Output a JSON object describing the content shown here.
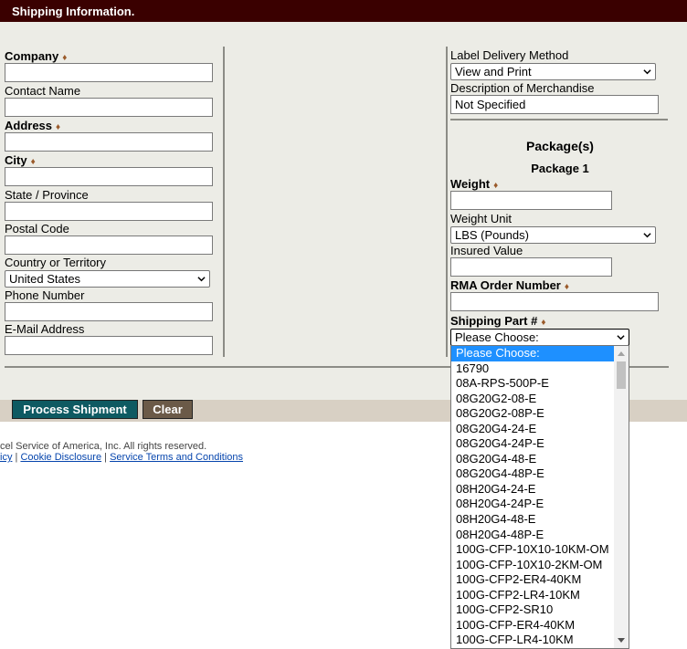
{
  "header": {
    "title": "Shipping Information."
  },
  "left_form": {
    "company": {
      "label": "Company",
      "value": ""
    },
    "contact_name": {
      "label": "Contact Name",
      "value": ""
    },
    "address": {
      "label": "Address",
      "value": ""
    },
    "city": {
      "label": "City",
      "value": ""
    },
    "state": {
      "label": "State / Province",
      "value": ""
    },
    "postal": {
      "label": "Postal Code",
      "value": ""
    },
    "country": {
      "label": "Country or Territory",
      "value": "United States"
    },
    "phone": {
      "label": "Phone Number",
      "value": ""
    },
    "email": {
      "label": "E-Mail Address",
      "value": ""
    }
  },
  "right_form": {
    "label_delivery": {
      "label": "Label Delivery Method",
      "value": "View and Print"
    },
    "description": {
      "label": "Description of Merchandise",
      "value": "Not Specified"
    },
    "packages_title": "Package(s)",
    "package1_title": "Package 1",
    "weight": {
      "label": "Weight",
      "value": ""
    },
    "weight_unit": {
      "label": "Weight Unit",
      "value": "LBS (Pounds)"
    },
    "insured": {
      "label": "Insured Value",
      "value": ""
    },
    "rma": {
      "label": "RMA Order Number",
      "value": ""
    },
    "shipping_part": {
      "label": "Shipping Part #",
      "value": "Please Choose:"
    }
  },
  "required_marker": "♦",
  "buttons": {
    "process": "Process Shipment",
    "clear": "Clear"
  },
  "footer": {
    "copyright": "cel Service of America, Inc. All rights reserved.",
    "link1": "icy",
    "sep": "|",
    "link2": "Cookie Disclosure",
    "link3": "Service Terms and Conditions"
  },
  "dropdown": {
    "options": [
      "Please Choose:",
      "16790",
      "08A-RPS-500P-E",
      "08G20G2-08-E",
      "08G20G2-08P-E",
      "08G20G4-24-E",
      "08G20G4-24P-E",
      "08G20G4-48-E",
      "08G20G4-48P-E",
      "08H20G4-24-E",
      "08H20G4-24P-E",
      "08H20G4-48-E",
      "08H20G4-48P-E",
      "100G-CFP-10X10-10KM-OM",
      "100G-CFP-10X10-2KM-OM",
      "100G-CFP2-ER4-40KM",
      "100G-CFP2-LR4-10KM",
      "100G-CFP2-SR10",
      "100G-CFP-ER4-40KM",
      "100G-CFP-LR4-10KM"
    ],
    "highlighted": "Please Choose:"
  },
  "colors": {
    "header_bg": "#3a0000",
    "panel_bg": "#ecece6",
    "process_btn": "#0e5a62",
    "clear_btn": "#6b5a48",
    "highlight": "#1e90ff"
  }
}
